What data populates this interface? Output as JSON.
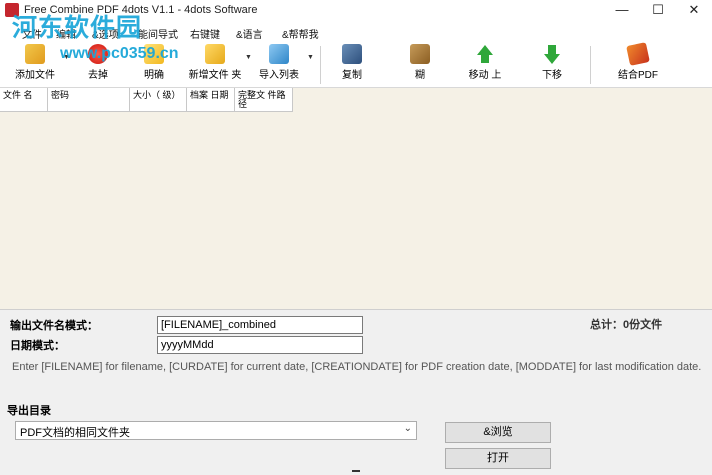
{
  "window": {
    "title": "Free Combine PDF 4dots V1.1 - 4dots Software",
    "minimize": "—",
    "maximize": "☐",
    "close": "✕"
  },
  "watermark": {
    "text": "河东软件园",
    "url": "www.pc0359.cn"
  },
  "menu": [
    "文件",
    "编辑",
    "&选项",
    "能间导式",
    "右键键",
    "&语言",
    "&帮帮我"
  ],
  "toolbar": {
    "buttons": [
      {
        "label": "添加文件",
        "icon": "add-file-icon"
      },
      {
        "label": "去掉",
        "icon": "remove-icon"
      },
      {
        "label": "明确",
        "icon": "clear-icon"
      },
      {
        "label": "新增文件 夹",
        "icon": "add-folder-icon"
      },
      {
        "label": "导入列表",
        "icon": "import-list-icon"
      },
      {
        "label": "复制",
        "icon": "copy-icon"
      },
      {
        "label": "糊",
        "icon": "paste-icon"
      },
      {
        "label": "移动 上",
        "icon": "move-up-icon"
      },
      {
        "label": "下移",
        "icon": "move-down-icon"
      },
      {
        "label": "结合PDF",
        "icon": "merge-pdf-icon"
      }
    ]
  },
  "grid": {
    "columns": [
      "文件 名",
      "密码",
      "大小（ 级）",
      "档案 日期",
      "完整文 件路径"
    ]
  },
  "output": {
    "filename_label": "输出文件名模式：",
    "filename_value": "[FILENAME]_combined",
    "date_label": "日期模式：",
    "date_value": "yyyyMMdd",
    "total": "总计：0份文件",
    "help": "Enter [FILENAME] for filename, [CURDATE] for current date, [CREATIONDATE] for PDF creation date, [MODDATE] for last modification date.",
    "dir_label": "导出目录",
    "dir_selected": "PDF文档的相同文件夹",
    "browse_label": "&浏览",
    "open_label": "打开"
  }
}
